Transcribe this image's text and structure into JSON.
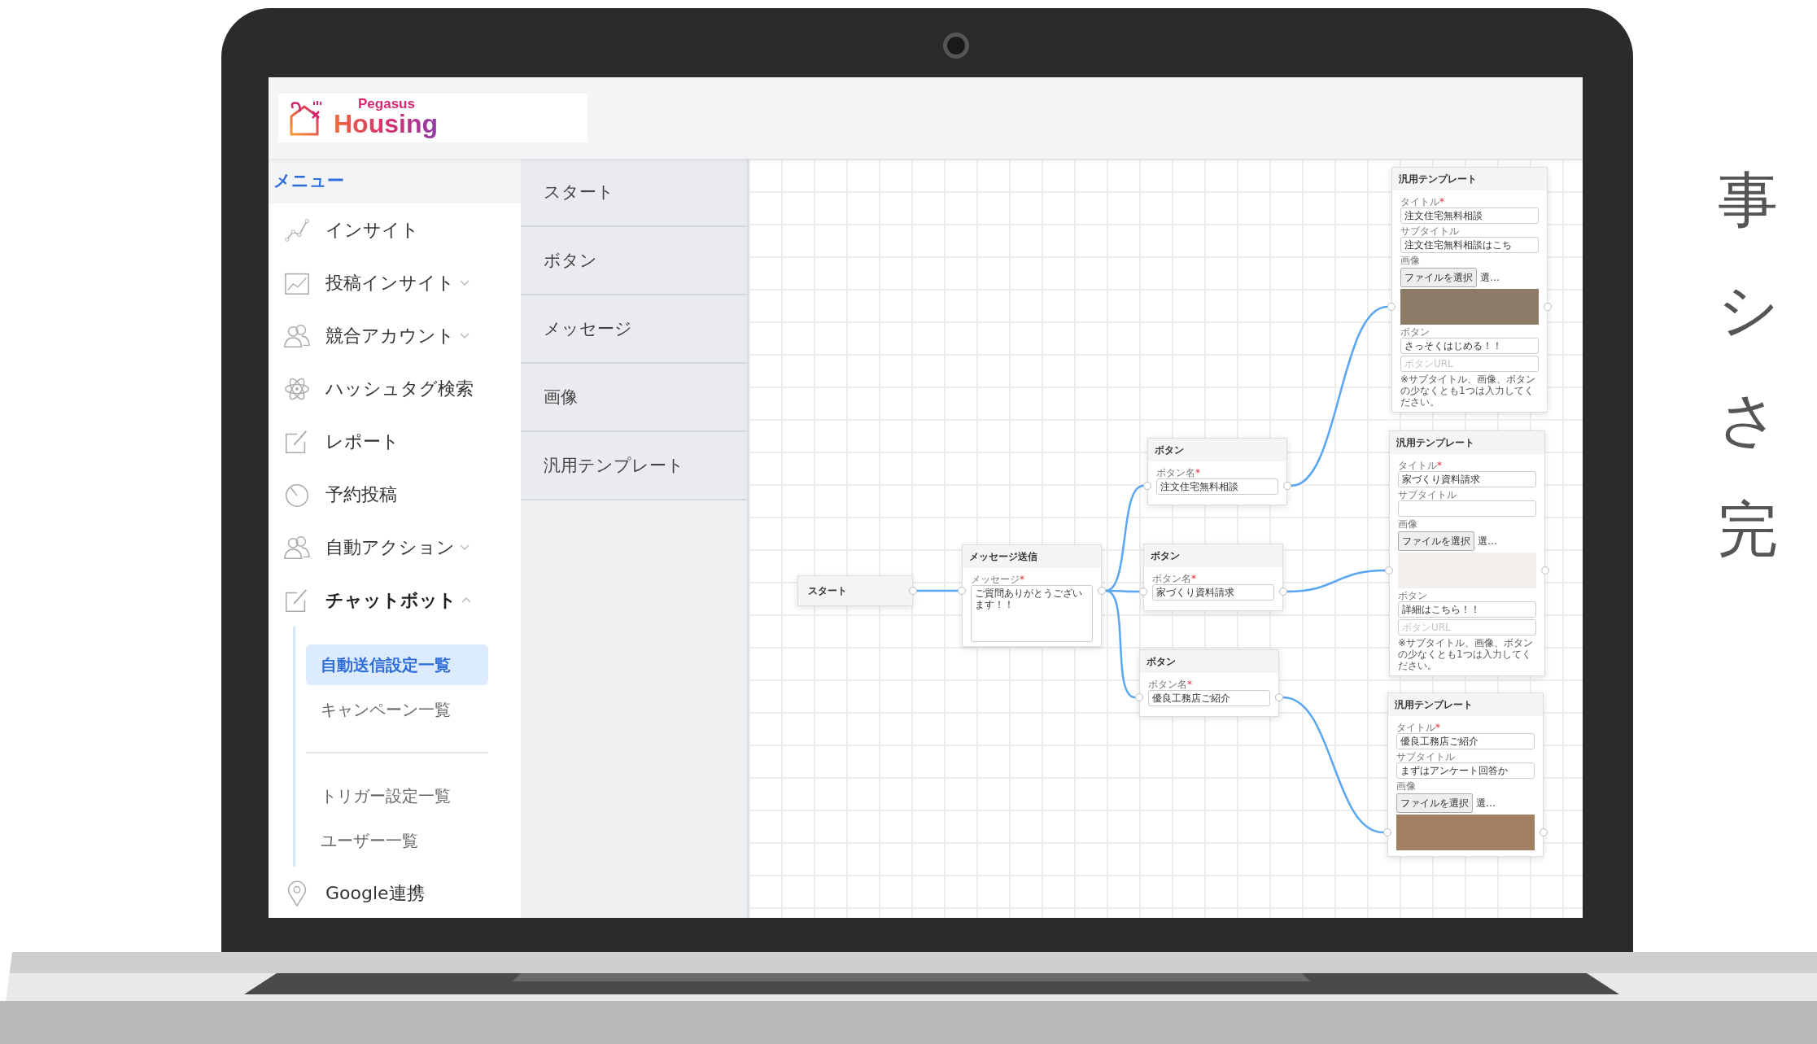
{
  "header": {
    "logo_top": "Pegasus",
    "logo_bottom": "Housing"
  },
  "sidebar": {
    "heading": "メニュー",
    "items": [
      {
        "label": "インサイト"
      },
      {
        "label": "投稿インサイト",
        "expanded": false
      },
      {
        "label": "競合アカウント",
        "expanded": false
      },
      {
        "label": "ハッシュタグ検索"
      },
      {
        "label": "レポート"
      },
      {
        "label": "予約投稿"
      },
      {
        "label": "自動アクション",
        "expanded": false
      },
      {
        "label": "チャットボット",
        "expanded": true,
        "children": [
          {
            "label": "自動送信設定一覧",
            "selected": true,
            "divider_before": false
          },
          {
            "label": "キャンペーン一覧",
            "selected": false,
            "divider_before": false
          },
          {
            "label": "トリガー設定一覧",
            "selected": false,
            "divider_before": true
          },
          {
            "label": "ユーザー一覧",
            "selected": false,
            "divider_before": false
          }
        ]
      },
      {
        "label": "Google連携"
      }
    ]
  },
  "palette": {
    "items": [
      "スタート",
      "ボタン",
      "メッセージ",
      "画像",
      "汎用テンプレート"
    ]
  },
  "canvas": {
    "nodes": [
      {
        "kind": "start",
        "title": "スタート"
      },
      {
        "kind": "message",
        "title": "メッセージ送信",
        "label": "メッセージ",
        "required_mark": "*",
        "value": "ご質問ありがとうございます！！"
      },
      {
        "kind": "button",
        "title": "ボタン",
        "label": "ボタン名",
        "required_mark": "*",
        "value": "注文住宅無料相談"
      },
      {
        "kind": "button",
        "title": "ボタン",
        "label": "ボタン名",
        "required_mark": "*",
        "value": "家づくり資料請求"
      },
      {
        "kind": "button",
        "title": "ボタン",
        "label": "ボタン名",
        "required_mark": "*",
        "value": "優良工務店ご紹介"
      },
      {
        "kind": "template",
        "title": "汎用テンプレート",
        "title_label": "タイトル",
        "required_mark": "*",
        "title_value": "注文住宅無料相談",
        "subtitle_label": "サブタイトル",
        "subtitle_value": "注文住宅無料相談はこち",
        "image_label": "画像",
        "file_button": "ファイルを選択",
        "file_status": "選…",
        "button_label": "ボタン",
        "button_value": "さっそくはじめる！！",
        "url_placeholder": "ボタンURL",
        "note": "※サブタイトル、画像、ボタンの少なくとも1つは入力してください。"
      },
      {
        "kind": "template",
        "title": "汎用テンプレート",
        "title_label": "タイトル",
        "required_mark": "*",
        "title_value": "家づくり資料請求",
        "subtitle_label": "サブタイトル",
        "image_label": "画像",
        "file_button": "ファイルを選択",
        "file_status": "選…",
        "button_label": "ボタン",
        "button_value": "詳細はこちら！！",
        "url_placeholder": "ボタンURL",
        "note": "※サブタイトル、画像、ボタンの少なくとも1つは入力してください。"
      },
      {
        "kind": "template",
        "title": "汎用テンプレート",
        "title_label": "タイトル",
        "required_mark": "*",
        "title_value": "優良工務店ご紹介",
        "subtitle_label": "サブタイトル",
        "subtitle_value": "まずはアンケート回答か",
        "image_label": "画像",
        "file_button": "ファイルを選択",
        "file_status": "選…"
      }
    ]
  },
  "caption_lines": [
    "事",
    "シ",
    "さ",
    "完"
  ]
}
